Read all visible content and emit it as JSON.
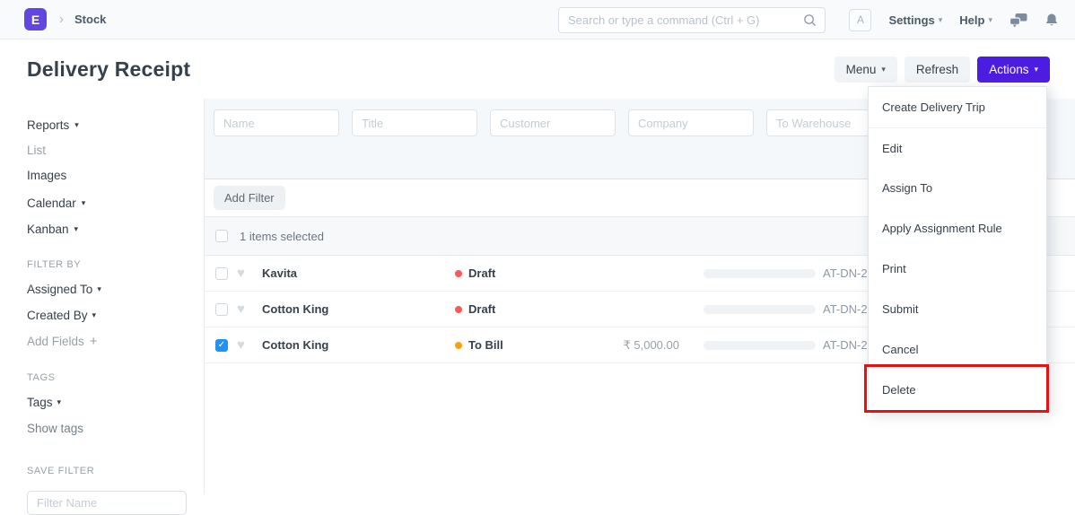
{
  "navbar": {
    "logo_letter": "E",
    "breadcrumb": "Stock",
    "search_placeholder": "Search or type a command (Ctrl + G)",
    "avatar_letter": "A",
    "settings_label": "Settings",
    "help_label": "Help"
  },
  "page": {
    "title": "Delivery Receipt",
    "menu_label": "Menu",
    "refresh_label": "Refresh",
    "actions_label": "Actions"
  },
  "actions_menu": {
    "items": [
      "Create Delivery Trip",
      "Edit",
      "Assign To",
      "Apply Assignment Rule",
      "Print",
      "Submit",
      "Cancel",
      "Delete"
    ],
    "highlighted_item": "Delete",
    "highlight_color": "#e81111"
  },
  "sidebar": {
    "views": [
      "Reports",
      "List",
      "Images",
      "Calendar",
      "Kanban"
    ],
    "filter_by_label": "FILTER BY",
    "assigned_to_label": "Assigned To",
    "created_by_label": "Created By",
    "add_fields_label": "Add Fields",
    "tags_section_label": "TAGS",
    "tags_label": "Tags",
    "show_tags_label": "Show tags",
    "save_filter_label": "SAVE FILTER",
    "filter_name_placeholder": "Filter Name"
  },
  "filters": {
    "placeholders": [
      "Name",
      "Title",
      "Customer",
      "Company",
      "To Warehouse"
    ],
    "add_filter_label": "Add Filter"
  },
  "list": {
    "selection_text": "1 items selected",
    "rows": [
      {
        "name": "Kavita",
        "status": "Draft",
        "status_color": "#ff5858",
        "amount": "",
        "id": "AT-DN-2",
        "checked": false
      },
      {
        "name": "Cotton King",
        "status": "Draft",
        "status_color": "#ff5858",
        "amount": "",
        "id": "AT-DN-2",
        "checked": false
      },
      {
        "name": "Cotton King",
        "status": "To Bill",
        "status_color": "#ffa00a",
        "amount": "₹ 5,000.00",
        "id": "AT-DN-2",
        "checked": true
      }
    ]
  },
  "colors": {
    "accent": "#4d1ce1",
    "logo": "#6246e2",
    "checked_checkbox": "#2490ef",
    "status_draft": "#ff5858",
    "status_to_bill": "#ffa00a"
  }
}
